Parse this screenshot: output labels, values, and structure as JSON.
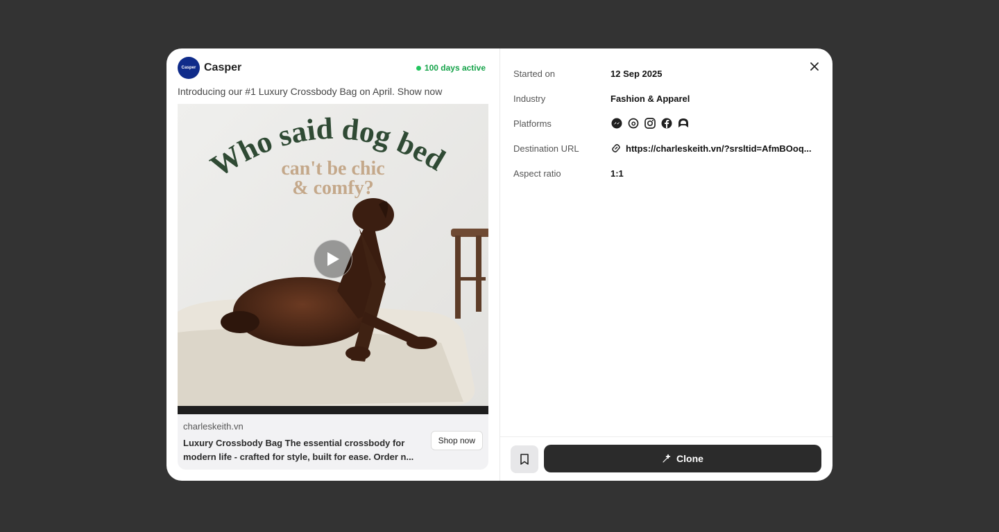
{
  "advertiser": {
    "avatar_text": "Casper",
    "name": "Casper",
    "status": "100 days active"
  },
  "ad": {
    "caption": "Introducing our #1 Luxury Crossbody Bag on April. Show now",
    "creative_headline_top": "Who said dog beds",
    "creative_headline_mid": "can't be chic",
    "creative_headline_bottom": "& comfy?",
    "domain": "charleskeith.vn",
    "headline": "Luxury Crossbody Bag The essential crossbody for modern life - crafted for style, built for ease. Order n...",
    "cta": "Shop now"
  },
  "details": {
    "started_label": "Started on",
    "started_value": "12 Sep 2025",
    "industry_label": "Industry",
    "industry_value": "Fashion & Apparel",
    "platforms_label": "Platforms",
    "platforms": [
      "messenger-icon",
      "threads-icon",
      "instagram-icon",
      "facebook-icon",
      "audience-network-icon"
    ],
    "url_label": "Destination URL",
    "url_value": "https://charleskeith.vn/?srsltid=AfmBOoq...",
    "aspect_label": "Aspect ratio",
    "aspect_value": "1:1"
  },
  "actions": {
    "clone_label": "Clone"
  },
  "colors": {
    "backdrop": "#333333",
    "active_green": "#16a34a",
    "headline_green": "#2f4a34",
    "headline_tan": "#c4a88a",
    "primary_button": "#2b2b2b"
  }
}
